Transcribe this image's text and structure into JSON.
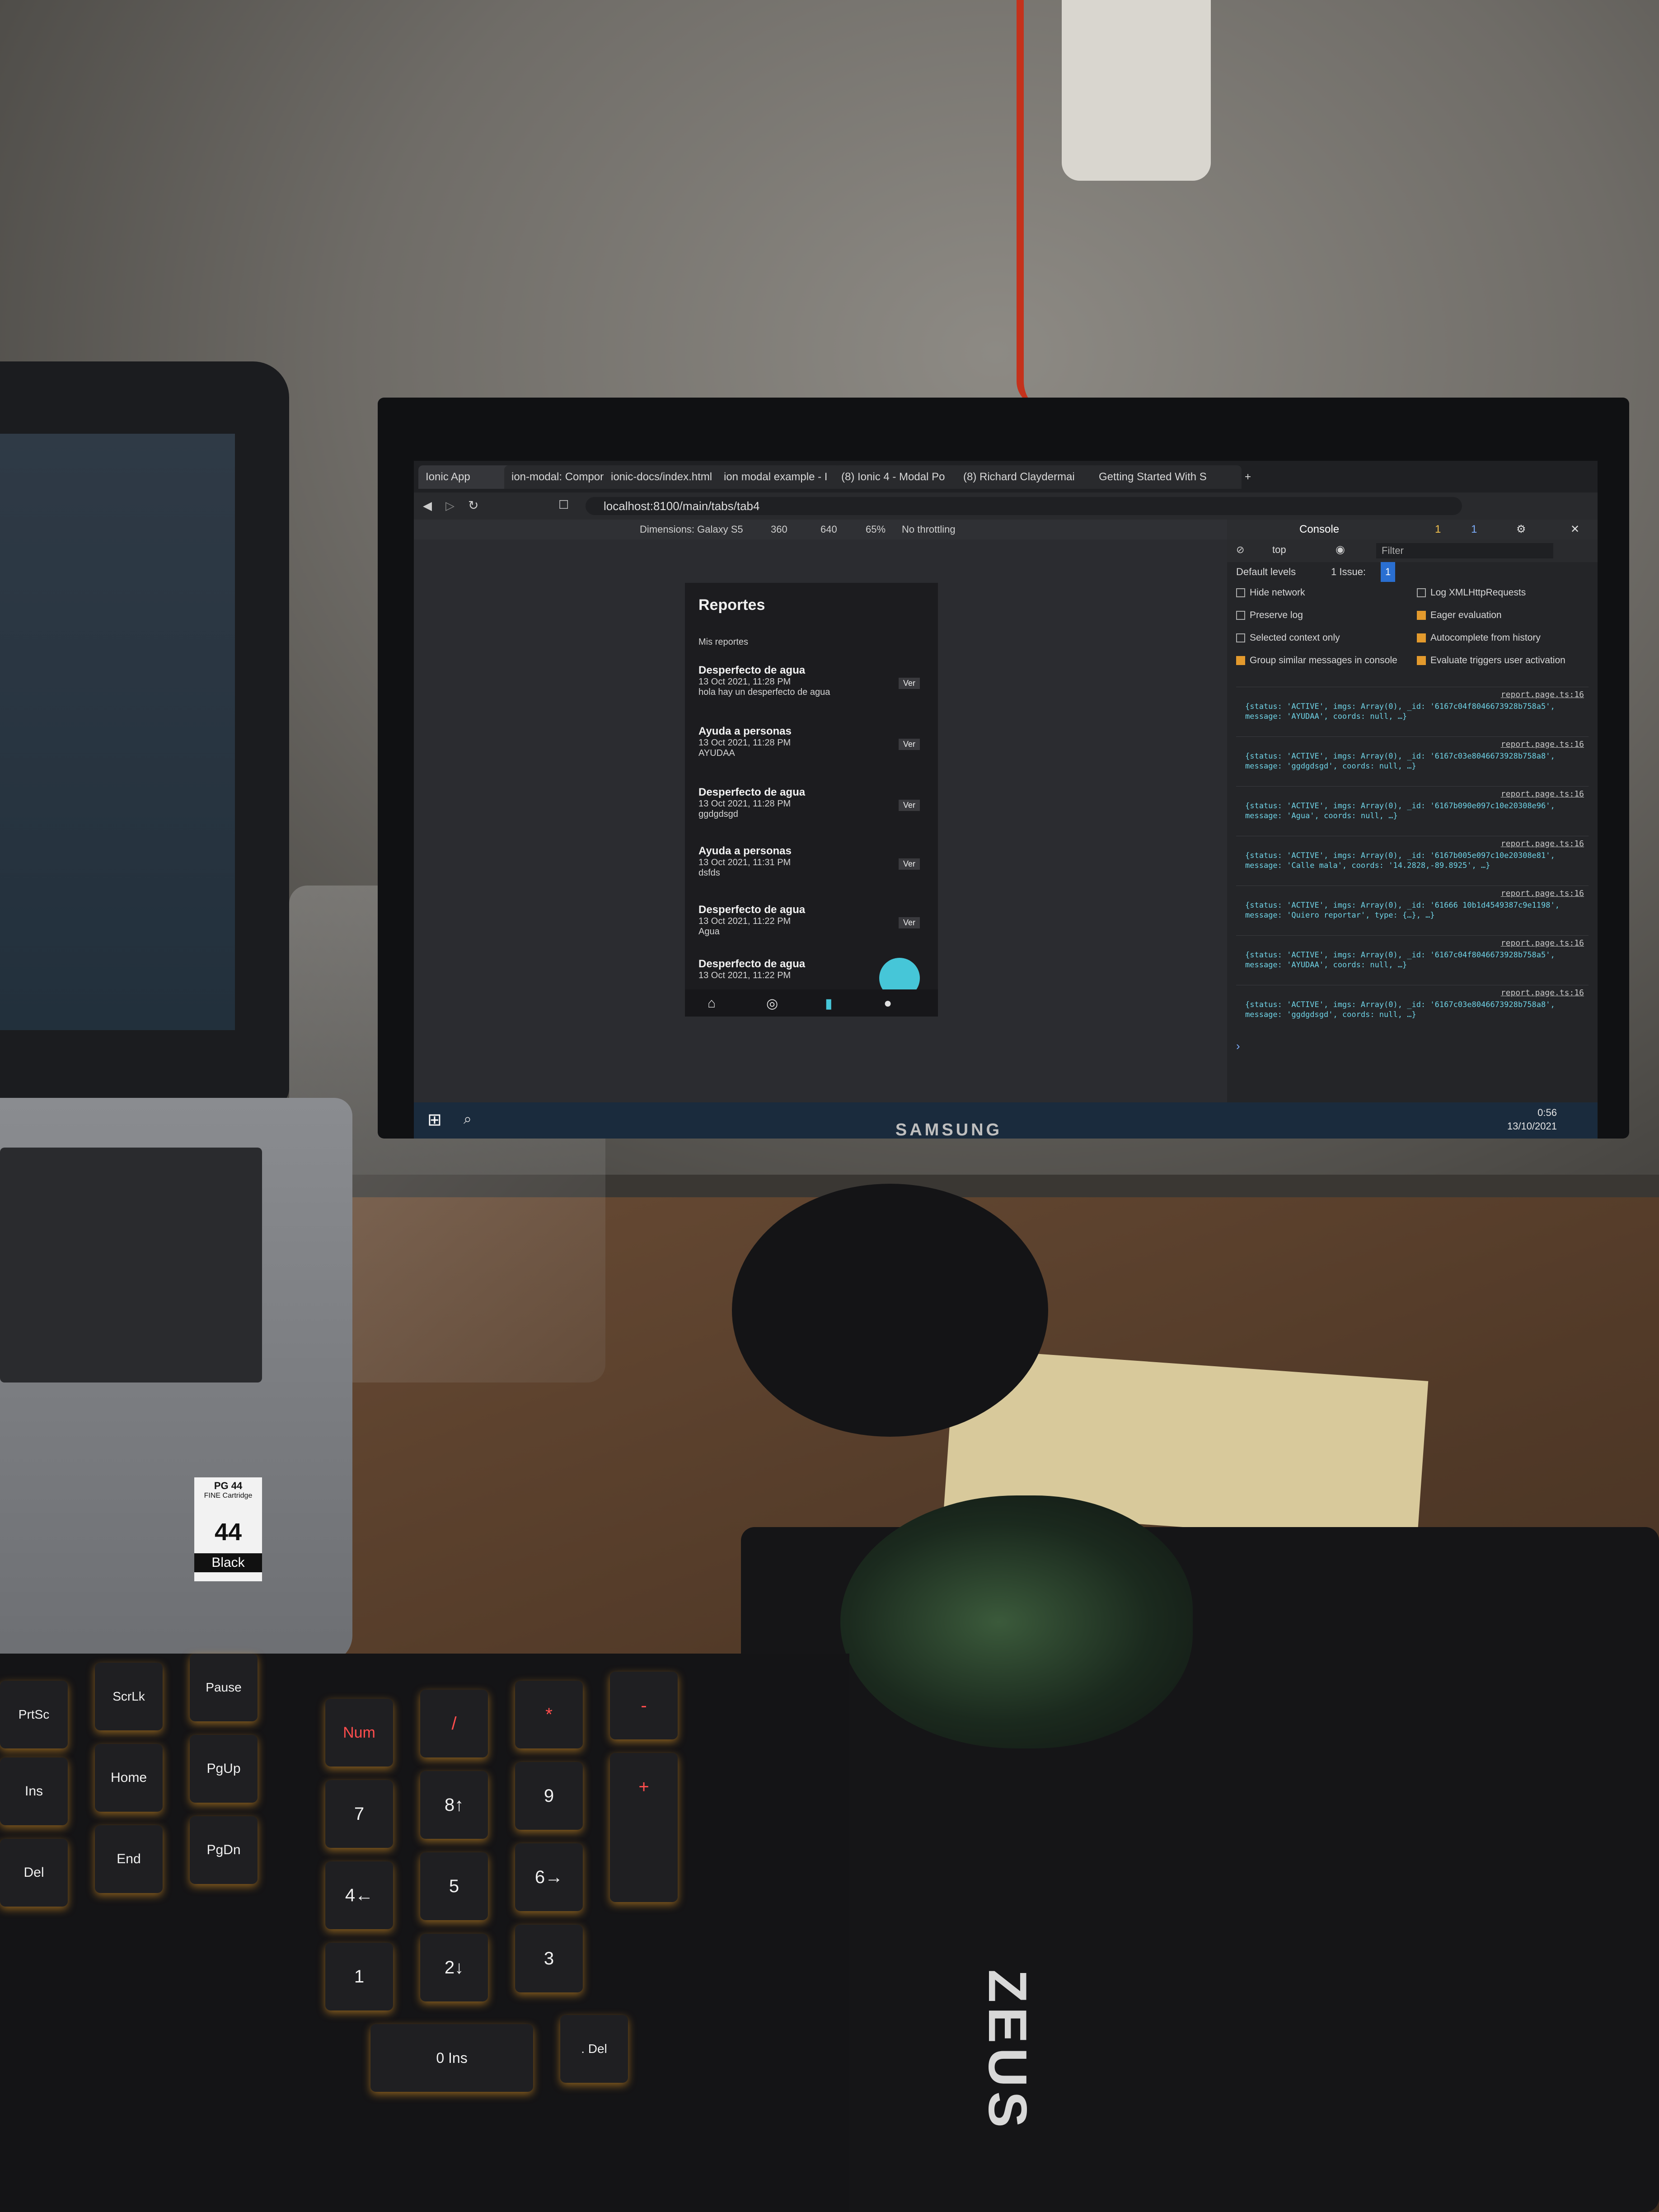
{
  "browser": {
    "tabs": [
      "Ionic App",
      "ion-modal: Componen",
      "ionic-docs/index.html",
      "ion modal example - I",
      "(8) Ionic 4 - Modal Po",
      "(8) Richard Claydermai",
      "Getting Started With S"
    ],
    "url": "localhost:8100/main/tabs/tab4"
  },
  "device_toolbar": {
    "device": "Dimensions: Galaxy S5",
    "width": "360",
    "height": "640",
    "zoom": "65%",
    "throttle": "No throttling"
  },
  "app": {
    "title": "Reportes",
    "subtitle": "Mis reportes",
    "view_label": "Ver",
    "reports": [
      {
        "title": "Desperfecto de agua",
        "date": "13 Oct 2021, 11:28 PM",
        "message": "hola hay un desperfecto de agua"
      },
      {
        "title": "Ayuda a personas",
        "date": "13 Oct 2021, 11:28 PM",
        "message": "AYUDAA"
      },
      {
        "title": "Desperfecto de agua",
        "date": "13 Oct 2021, 11:28 PM",
        "message": "ggdgdsgd"
      },
      {
        "title": "Ayuda a personas",
        "date": "13 Oct 2021, 11:31 PM",
        "message": "dsfds"
      },
      {
        "title": "Desperfecto de agua",
        "date": "13 Oct 2021, 11:22 PM",
        "message": "Agua"
      },
      {
        "title": "Desperfecto de agua",
        "date": "13 Oct 2021, 11:22 PM",
        "message": ""
      }
    ],
    "nav_icons": [
      "home-icon",
      "compass-icon",
      "document-icon",
      "person-icon"
    ]
  },
  "devtools": {
    "tab": "Console",
    "context": "top",
    "filter_placeholder": "Filter",
    "levels": "Default levels",
    "issues": "1 Issue:",
    "issue_count": "1",
    "badge_warn": "1",
    "badge_info": "1",
    "options": [
      {
        "label": "Hide network",
        "checked": false
      },
      {
        "label": "Log XMLHttpRequests",
        "checked": false
      },
      {
        "label": "Preserve log",
        "checked": false
      },
      {
        "label": "Eager evaluation",
        "checked": true
      },
      {
        "label": "Selected context only",
        "checked": false
      },
      {
        "label": "Autocomplete from history",
        "checked": true
      },
      {
        "label": "Group similar messages in console",
        "checked": true
      },
      {
        "label": "Evaluate triggers user activation",
        "checked": true
      }
    ],
    "logs": [
      {
        "source": "report.page.ts:16",
        "text": "{status: 'ACTIVE', imgs: Array(0), _id: '6167c04f8046673928b758a5', message: 'AYUDAA', coords: null, …}"
      },
      {
        "source": "report.page.ts:16",
        "text": "{status: 'ACTIVE', imgs: Array(0), _id: '6167c03e8046673928b758a8', message: 'ggdgdsgd', coords: null, …}"
      },
      {
        "source": "report.page.ts:16",
        "text": "{status: 'ACTIVE', imgs: Array(0), _id: '6167b090e097c10e20308e96', message: 'Agua', coords: null, …}"
      },
      {
        "source": "report.page.ts:16",
        "text": "{status: 'ACTIVE', imgs: Array(0), _id: '6167b005e097c10e20308e81', message: 'Calle mala', coords: '14.2828,-89.8925', …}"
      },
      {
        "source": "report.page.ts:16",
        "text": "{status: 'ACTIVE', imgs: Array(0), _id: '61666 10b1d4549387c9e1198', message: 'Quiero reportar', type: {…}, …}"
      },
      {
        "source": "report.page.ts:16",
        "text": "{status: 'ACTIVE', imgs: Array(0), _id: '6167c04f8046673928b758a5', message: 'AYUDAA', coords: null, …}"
      },
      {
        "source": "report.page.ts:16",
        "text": "{status: 'ACTIVE', imgs: Array(0), _id: '6167c03e8046673928b758a8', message: 'ggdgdsgd', coords: null, …}"
      }
    ]
  },
  "taskbar": {
    "time": "0:56",
    "date": "13/10/2021"
  },
  "monitor_brand": "SAMSUNG",
  "cartridge": {
    "line1": "PG 44",
    "line2": "FINE Cartridge",
    "number": "44",
    "color": "Black"
  },
  "keyboard": {
    "keys": [
      "PrtSc",
      "ScrLk",
      "Pause",
      "Ins",
      "Home",
      "PgUp",
      "Del",
      "End",
      "PgDn",
      "Num",
      "/",
      "*",
      "-",
      "7",
      "8↑",
      "9",
      "+",
      "4←",
      "5",
      "6→",
      "1",
      "2↓",
      "3",
      "0 Ins",
      ". Del"
    ]
  },
  "mousepad_brand": "ZEUS"
}
